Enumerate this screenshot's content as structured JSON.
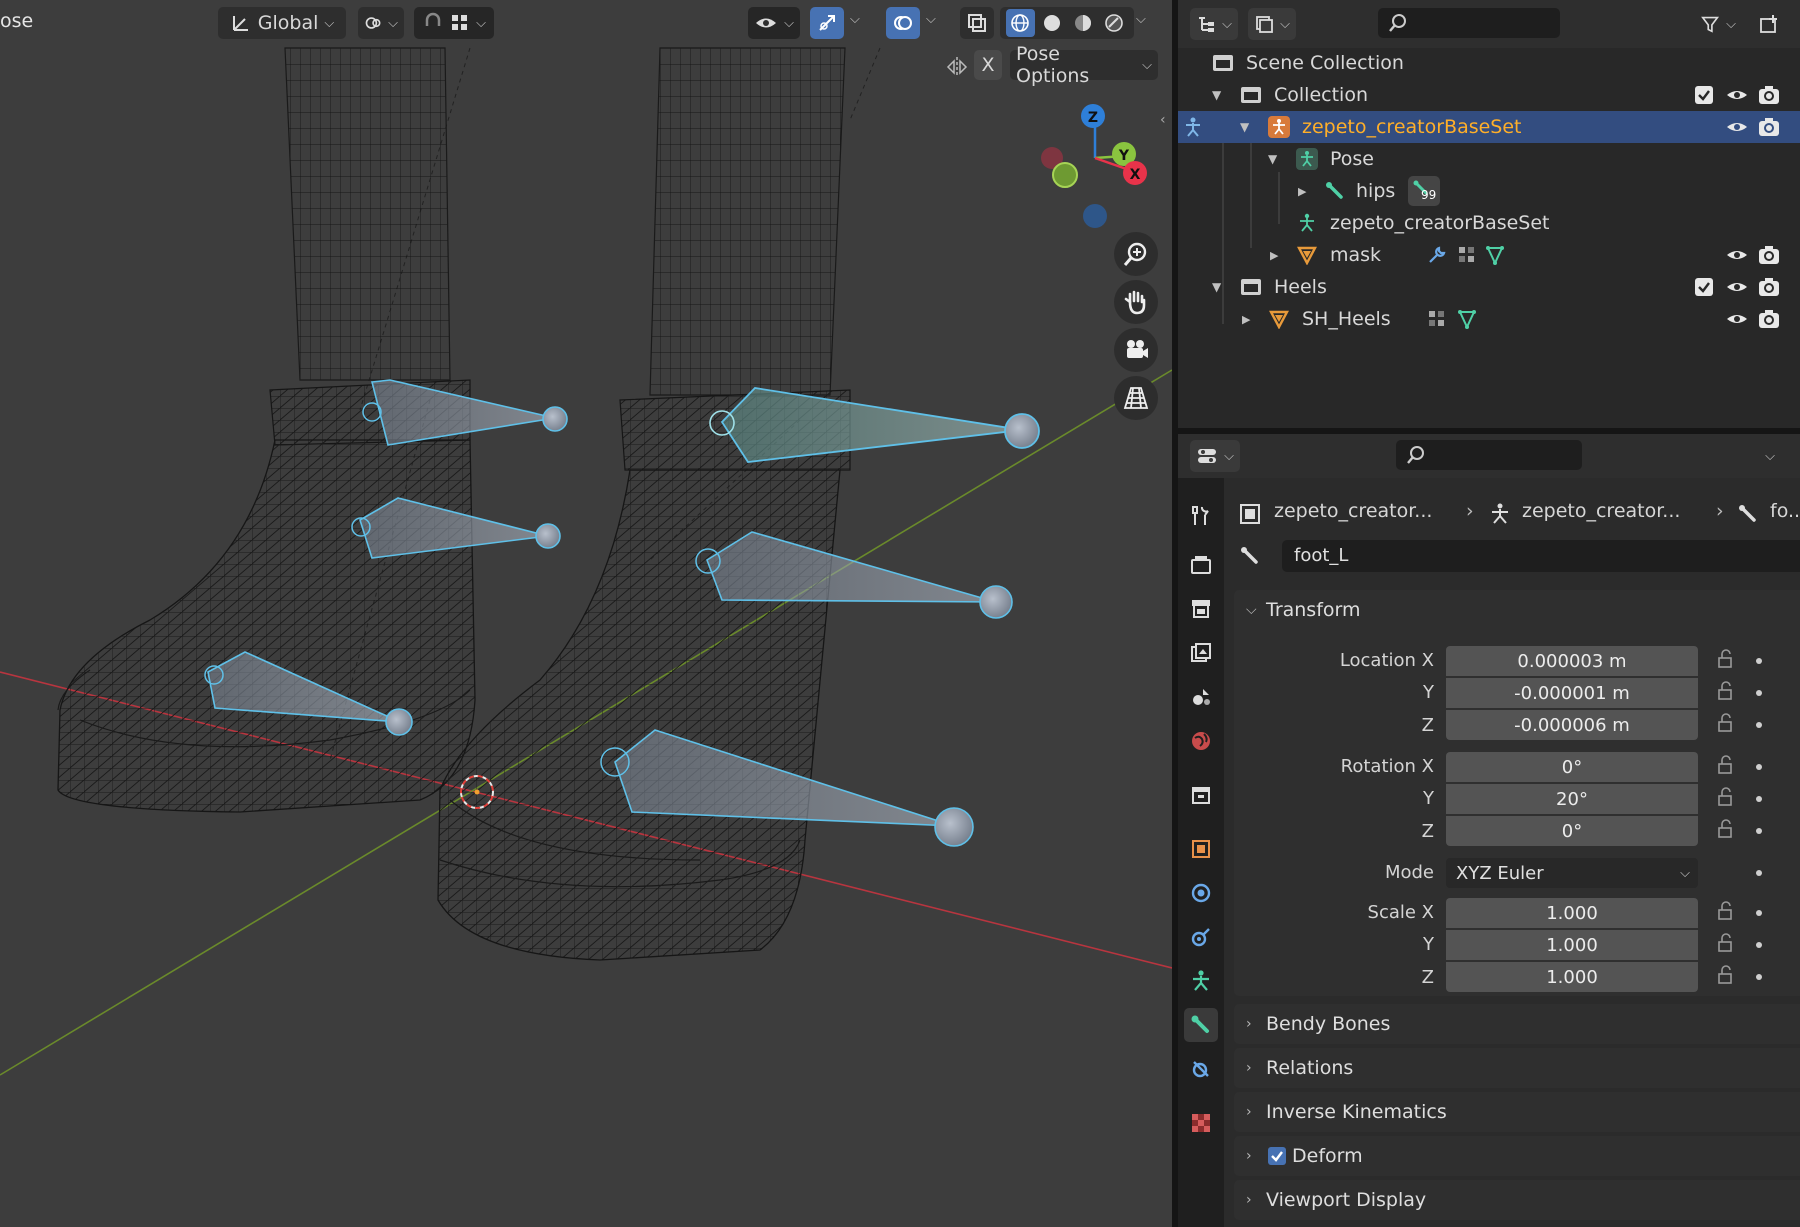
{
  "viewport": {
    "mode_label": "ose",
    "orientation": "Global",
    "pose_options_label": "Pose Options",
    "x_mirror_label": "X",
    "gizmo": {
      "z": "Z",
      "y": "Y",
      "x": "X"
    }
  },
  "outliner": {
    "rows": [
      {
        "label": "Scene Collection",
        "icon": "scene-collection-icon"
      },
      {
        "label": "Collection",
        "icon": "collection-icon"
      },
      {
        "label": "zepeto_creatorBaseSet",
        "icon": "armature-icon",
        "selected": true
      },
      {
        "label": "Pose",
        "icon": "pose-icon"
      },
      {
        "label": "hips",
        "icon": "bone-icon",
        "badge": "99"
      },
      {
        "label": "zepeto_creatorBaseSet",
        "icon": "armature-data-icon"
      },
      {
        "label": "mask",
        "icon": "mesh-icon"
      },
      {
        "label": "Heels",
        "icon": "collection-icon"
      },
      {
        "label": "SH_Heels",
        "icon": "mesh-icon"
      }
    ]
  },
  "properties": {
    "breadcrumb": [
      "zepeto_creator...",
      "zepeto_creator...",
      "fo..."
    ],
    "bone_name": "foot_L",
    "transform": {
      "title": "Transform",
      "location_label_x": "Location X",
      "axis_y": "Y",
      "axis_z": "Z",
      "location": [
        "0.000003 m",
        "-0.000001 m",
        "-0.000006 m"
      ],
      "rotation_label_x": "Rotation X",
      "rotation": [
        "0°",
        "20°",
        "0°"
      ],
      "mode_label": "Mode",
      "mode_value": "XYZ Euler",
      "scale_label_x": "Scale X",
      "scale": [
        "1.000",
        "1.000",
        "1.000"
      ]
    },
    "panels": [
      "Bendy Bones",
      "Relations",
      "Inverse Kinematics",
      "Deform",
      "Viewport Display"
    ]
  },
  "colors": {
    "selection": "#334d80",
    "accent_blue": "#4772b3",
    "active_object_text": "#ffaf29",
    "bone_outline": "#5fc0e8",
    "axis_x": "#e8334a",
    "axis_y": "#8ac43f",
    "axis_z": "#2e7fd8"
  }
}
